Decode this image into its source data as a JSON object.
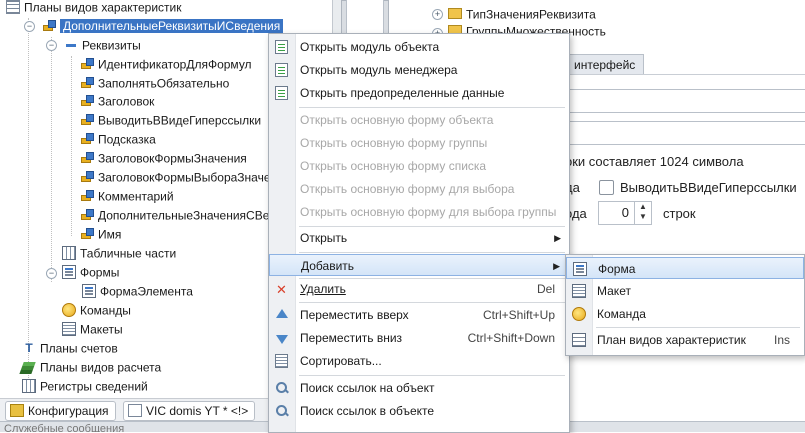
{
  "tree": {
    "items": [
      {
        "label": "Планы видов характеристик",
        "icon": "grid-icon"
      },
      {
        "label": "ДополнительныеРеквизитыИСведения",
        "icon": "key-icon",
        "selected": true
      },
      {
        "label": "Реквизиты",
        "icon": "attribute-group-icon"
      },
      {
        "label": "ИдентификаторДляФормул",
        "icon": "attribute-icon"
      },
      {
        "label": "ЗаполнятьОбязательно",
        "icon": "attribute-icon"
      },
      {
        "label": "Заголовок",
        "icon": "attribute-icon"
      },
      {
        "label": "ВыводитьВВидеГиперссылки",
        "icon": "attribute-icon"
      },
      {
        "label": "Подсказка",
        "icon": "attribute-icon"
      },
      {
        "label": "ЗаголовокФормыЗначения",
        "icon": "attribute-icon"
      },
      {
        "label": "ЗаголовокФормыВыбораЗначен",
        "icon": "attribute-icon"
      },
      {
        "label": "Комментарий",
        "icon": "attribute-icon"
      },
      {
        "label": "ДополнительныеЗначенияСВесо",
        "icon": "attribute-icon"
      },
      {
        "label": "Имя",
        "icon": "attribute-icon"
      },
      {
        "label": "Табличные части",
        "icon": "table-icon"
      },
      {
        "label": "Формы",
        "icon": "form-icon"
      },
      {
        "label": "ФормаЭлемента",
        "icon": "form-icon"
      },
      {
        "label": "Команды",
        "icon": "command-icon"
      },
      {
        "label": "Макеты",
        "icon": "template-icon"
      },
      {
        "label": "Планы счетов",
        "icon": "accounts-icon"
      },
      {
        "label": "Планы видов расчета",
        "icon": "layers-icon"
      },
      {
        "label": "Регистры сведений",
        "icon": "register-icon"
      }
    ]
  },
  "tabs": [
    {
      "label": "Конфигурация"
    },
    {
      "label": "VIC domis YT * <!>"
    }
  ],
  "status_bar": {
    "label": "Служебные сообщения"
  },
  "right": {
    "tree_item_1": "ТипЗначенияРеквизита",
    "tree_item_2": "ГруппыМножественность",
    "tab_interface": "интерфейс",
    "length_text": "оки составляет 1024 символа",
    "label_da": "да",
    "label_oda": "ода",
    "checkbox_label": "ВыводитьВВидеГиперссылки",
    "spin_value": "0",
    "spin_unit": "строк"
  },
  "context_menu": {
    "items": [
      {
        "label": "Открыть модуль объекта",
        "enabled": true,
        "icon": "module-icon"
      },
      {
        "label": "Открыть модуль менеджера",
        "enabled": true,
        "icon": "module-icon"
      },
      {
        "label": "Открыть предопределенные данные",
        "enabled": true,
        "icon": "predefined-icon"
      },
      {
        "label": "Открыть основную форму объекта",
        "enabled": false
      },
      {
        "label": "Открыть основную форму группы",
        "enabled": false
      },
      {
        "label": "Открыть основную форму списка",
        "enabled": false
      },
      {
        "label": "Открыть основную форму для выбора",
        "enabled": false
      },
      {
        "label": "Открыть основную форму для выбора группы",
        "enabled": false
      },
      {
        "label": "Открыть",
        "enabled": true,
        "submenu": true
      },
      {
        "label": "Добавить",
        "enabled": true,
        "submenu": true,
        "highlighted": true
      },
      {
        "label": "Удалить",
        "enabled": true,
        "shortcut": "Del",
        "icon": "delete-icon"
      },
      {
        "label": "Переместить вверх",
        "enabled": true,
        "shortcut": "Ctrl+Shift+Up",
        "icon": "arrow-up-icon"
      },
      {
        "label": "Переместить вниз",
        "enabled": true,
        "shortcut": "Ctrl+Shift+Down",
        "icon": "arrow-down-icon"
      },
      {
        "label": "Сортировать...",
        "enabled": true,
        "icon": "sort-icon"
      },
      {
        "label": "Поиск ссылок на объект",
        "enabled": true,
        "icon": "find-icon"
      },
      {
        "label": "Поиск ссылок в объекте",
        "enabled": true,
        "icon": "find-icon"
      }
    ]
  },
  "submenu": {
    "items": [
      {
        "label": "Форма",
        "icon": "form-icon",
        "highlighted": true
      },
      {
        "label": "Макет",
        "icon": "template-icon"
      },
      {
        "label": "Команда",
        "icon": "command-icon"
      },
      {
        "label": "План видов характеристик",
        "icon": "grid-icon",
        "shortcut": "Ins"
      }
    ]
  }
}
